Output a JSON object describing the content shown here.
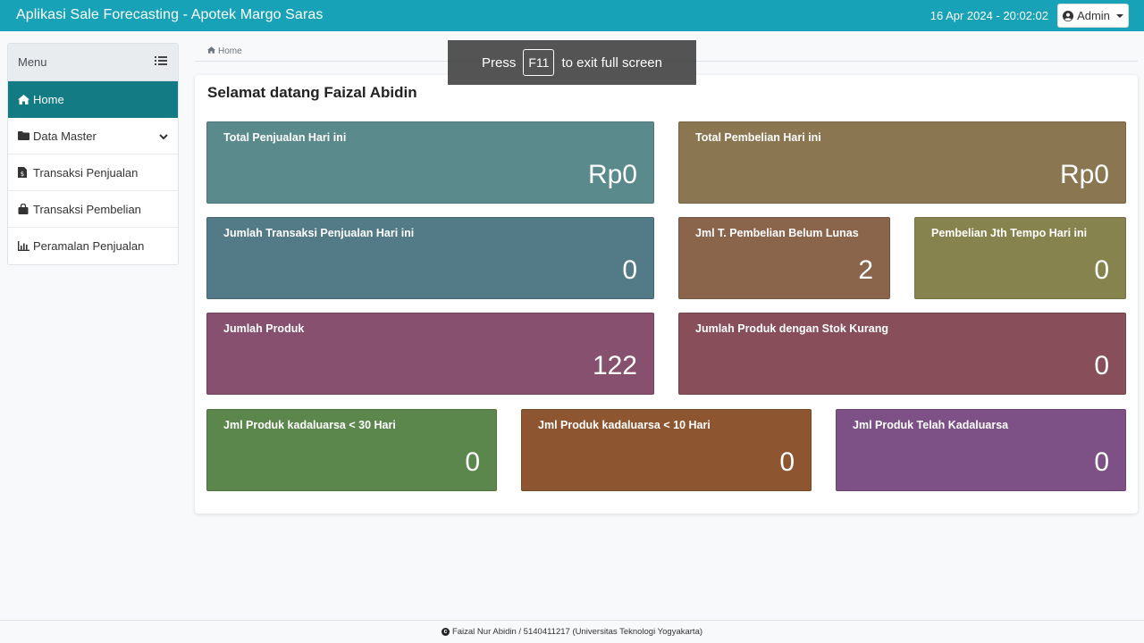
{
  "navbar": {
    "app_title": "Aplikasi Sale Forecasting - Apotek Margo Saras",
    "datetime": "16 Apr 2024 -  20:02:02",
    "user_button": "Admin"
  },
  "fullscreen_toast": {
    "press": "Press",
    "key": "F11",
    "suffix": "to exit full screen"
  },
  "sidebar": {
    "header": "Menu",
    "items": [
      {
        "label": "Home",
        "icon": "home-icon",
        "active": true
      },
      {
        "label": "Data Master",
        "icon": "folder-icon",
        "has_submenu": true
      },
      {
        "label": "Transaksi Penjualan",
        "icon": "invoice-icon"
      },
      {
        "label": "Transaksi Pembelian",
        "icon": "shopping-bag-icon"
      },
      {
        "label": "Peramalan Penjualan",
        "icon": "bar-chart-icon"
      }
    ]
  },
  "breadcrumb": {
    "home": "Home"
  },
  "main": {
    "welcome": "Selamat datang Faizal Abidin",
    "tiles": [
      {
        "label": "Total Penjualan Hari ini",
        "value": "Rp0",
        "color": "#5a8a8c"
      },
      {
        "label": "Total Pembelian Hari ini",
        "value": "Rp0",
        "color": "#8a7650"
      },
      {
        "label": "Jumlah Transaksi Penjualan Hari ini",
        "value": "0",
        "color": "#527a87"
      },
      {
        "label": "Jml T. Pembelian Belum Lunas",
        "value": "2",
        "color": "#8a654c"
      },
      {
        "label": "Pembelian Jth Tempo Hari ini",
        "value": "0",
        "color": "#87834f"
      },
      {
        "label": "Jumlah Produk",
        "value": "122",
        "color": "#87506e"
      },
      {
        "label": "Jumlah Produk dengan Stok Kurang",
        "value": "0",
        "color": "#884f5a"
      },
      {
        "label": "Jml Produk kadaluarsa < 30 Hari",
        "value": "0",
        "color": "#5b864c"
      },
      {
        "label": "Jml Produk kadaluarsa < 10 Hari",
        "value": "0",
        "color": "#8d5530"
      },
      {
        "label": "Jml Produk Telah Kadaluarsa",
        "value": "0",
        "color": "#7d5186"
      }
    ]
  },
  "footer": {
    "text": "Faizal Nur Abidin / 5140411217 (Universitas Teknologi Yogyakarta)"
  }
}
